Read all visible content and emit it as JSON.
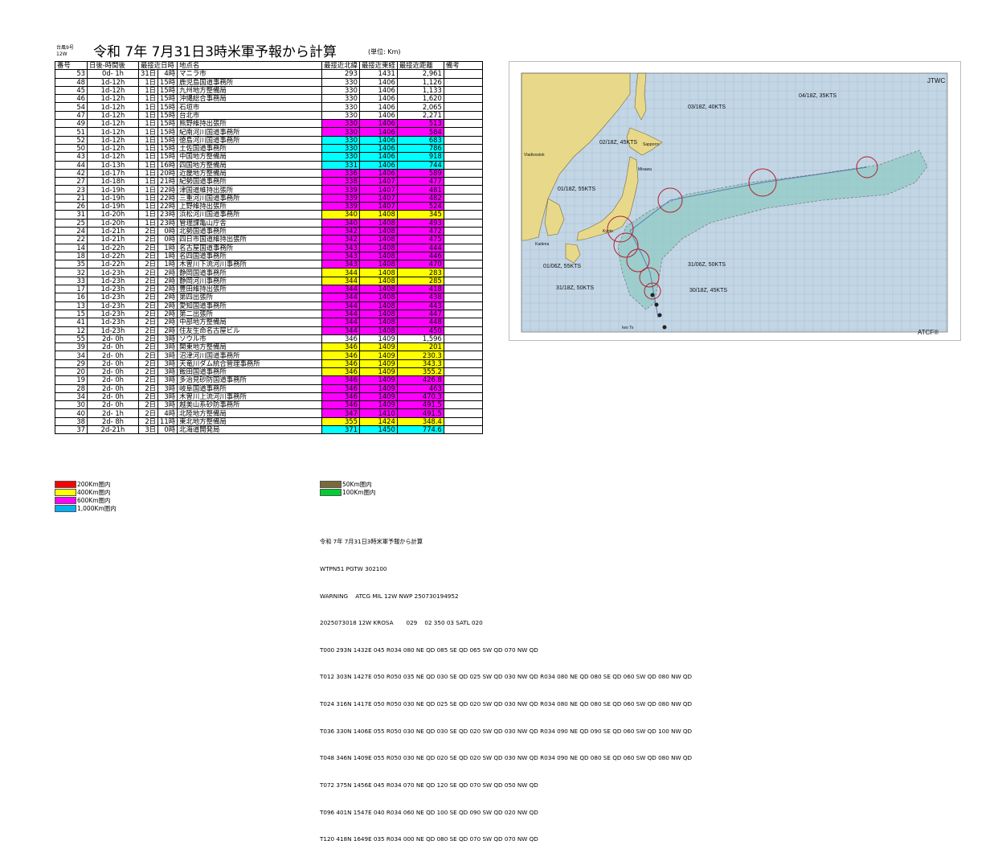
{
  "header": {
    "storm_label": "台風9号",
    "storm_sub": "12W",
    "title": "令和 7年 7月31日3時米軍予報から計算",
    "unit": "(単位: Km)"
  },
  "table": {
    "columns": [
      "番号",
      "日後-時間後",
      "最接近日時",
      "地点名",
      "最接近北緯",
      "最接近東経",
      "最接近距離",
      "備考"
    ],
    "rows": [
      {
        "no": "53",
        "after": "0d- 1h",
        "date": "31日",
        "time": "4時",
        "name": "マニラ市",
        "lat": "293",
        "lon": "1431",
        "dist": "2,961",
        "color": "none"
      },
      {
        "no": "48",
        "after": "1d-12h",
        "date": "1日",
        "time": "15時",
        "name": "鹿児島国道事務所",
        "lat": "330",
        "lon": "1406",
        "dist": "1,126",
        "color": "none"
      },
      {
        "no": "45",
        "after": "1d-12h",
        "date": "1日",
        "time": "15時",
        "name": "九州地方整備局",
        "lat": "330",
        "lon": "1406",
        "dist": "1,133",
        "color": "none"
      },
      {
        "no": "46",
        "after": "1d-12h",
        "date": "1日",
        "time": "15時",
        "name": "沖縄総合事務局",
        "lat": "330",
        "lon": "1406",
        "dist": "1,620",
        "color": "none"
      },
      {
        "no": "54",
        "after": "1d-12h",
        "date": "1日",
        "time": "15時",
        "name": "石垣市",
        "lat": "330",
        "lon": "1406",
        "dist": "2,065",
        "color": "none"
      },
      {
        "no": "47",
        "after": "1d-12h",
        "date": "1日",
        "time": "15時",
        "name": "台北市",
        "lat": "330",
        "lon": "1406",
        "dist": "2,271",
        "color": "none"
      },
      {
        "no": "49",
        "after": "1d-12h",
        "date": "1日",
        "time": "15時",
        "name": "熊野維持出張所",
        "lat": "330",
        "lon": "1406",
        "dist": "513",
        "color": "magenta"
      },
      {
        "no": "51",
        "after": "1d-12h",
        "date": "1日",
        "time": "15時",
        "name": "紀南河川国道事務所",
        "lat": "330",
        "lon": "1406",
        "dist": "584",
        "color": "magenta"
      },
      {
        "no": "52",
        "after": "1d-12h",
        "date": "1日",
        "time": "15時",
        "name": "徳島河川国道事務所",
        "lat": "330",
        "lon": "1406",
        "dist": "683",
        "color": "cyan"
      },
      {
        "no": "50",
        "after": "1d-12h",
        "date": "1日",
        "time": "15時",
        "name": "土佐国道事務所",
        "lat": "330",
        "lon": "1406",
        "dist": "786",
        "color": "cyan"
      },
      {
        "no": "43",
        "after": "1d-12h",
        "date": "1日",
        "time": "15時",
        "name": "中国地方整備局",
        "lat": "330",
        "lon": "1406",
        "dist": "918",
        "color": "cyan"
      },
      {
        "no": "44",
        "after": "1d-13h",
        "date": "1日",
        "time": "16時",
        "name": "四国地方整備局",
        "lat": "331",
        "lon": "1406",
        "dist": "744",
        "color": "cyan"
      },
      {
        "no": "42",
        "after": "1d-17h",
        "date": "1日",
        "time": "20時",
        "name": "近畿地方整備局",
        "lat": "336",
        "lon": "1406",
        "dist": "589",
        "color": "magenta"
      },
      {
        "no": "27",
        "after": "1d-18h",
        "date": "1日",
        "time": "21時",
        "name": "紀勢国道事務所",
        "lat": "338",
        "lon": "1407",
        "dist": "477",
        "color": "magenta"
      },
      {
        "no": "23",
        "after": "1d-19h",
        "date": "1日",
        "time": "22時",
        "name": "津国道維持出張所",
        "lat": "339",
        "lon": "1407",
        "dist": "481",
        "color": "magenta"
      },
      {
        "no": "21",
        "after": "1d-19h",
        "date": "1日",
        "time": "22時",
        "name": "三重河川国道事務所",
        "lat": "339",
        "lon": "1407",
        "dist": "482",
        "color": "magenta"
      },
      {
        "no": "26",
        "after": "1d-19h",
        "date": "1日",
        "time": "22時",
        "name": "上野維持出張所",
        "lat": "339",
        "lon": "1407",
        "dist": "524",
        "color": "magenta"
      },
      {
        "no": "31",
        "after": "1d-20h",
        "date": "1日",
        "time": "23時",
        "name": "浜松河川国道事務所",
        "lat": "340",
        "lon": "1408",
        "dist": "345",
        "color": "yellow"
      },
      {
        "no": "25",
        "after": "1d-20h",
        "date": "1日",
        "time": "23時",
        "name": "管理課亀山庁舎",
        "lat": "340",
        "lon": "1408",
        "dist": "493",
        "color": "magenta"
      },
      {
        "no": "24",
        "after": "1d-21h",
        "date": "2日",
        "time": "0時",
        "name": "北勢国道事務所",
        "lat": "342",
        "lon": "1408",
        "dist": "472",
        "color": "magenta"
      },
      {
        "no": "22",
        "after": "1d-21h",
        "date": "2日",
        "time": "0時",
        "name": "四日市国道維持出張所",
        "lat": "342",
        "lon": "1408",
        "dist": "475",
        "color": "magenta"
      },
      {
        "no": "14",
        "after": "1d-22h",
        "date": "2日",
        "time": "1時",
        "name": "名古屋国道事務所",
        "lat": "343",
        "lon": "1408",
        "dist": "444",
        "color": "magenta"
      },
      {
        "no": "18",
        "after": "1d-22h",
        "date": "2日",
        "time": "1時",
        "name": "名四国道事務所",
        "lat": "343",
        "lon": "1408",
        "dist": "446",
        "color": "magenta"
      },
      {
        "no": "35",
        "after": "1d-22h",
        "date": "2日",
        "time": "1時",
        "name": "木曽川下流河川事務所",
        "lat": "343",
        "lon": "1408",
        "dist": "470",
        "color": "magenta"
      },
      {
        "no": "32",
        "after": "1d-23h",
        "date": "2日",
        "time": "2時",
        "name": "静岡国道事務所",
        "lat": "344",
        "lon": "1408",
        "dist": "283",
        "color": "yellow"
      },
      {
        "no": "33",
        "after": "1d-23h",
        "date": "2日",
        "time": "2時",
        "name": "静岡河川事務所",
        "lat": "344",
        "lon": "1408",
        "dist": "285",
        "color": "yellow"
      },
      {
        "no": "17",
        "after": "1d-23h",
        "date": "2日",
        "time": "2時",
        "name": "豊田維持出張所",
        "lat": "344",
        "lon": "1408",
        "dist": "418",
        "color": "magenta"
      },
      {
        "no": "16",
        "after": "1d-23h",
        "date": "2日",
        "time": "2時",
        "name": "第四出張所",
        "lat": "344",
        "lon": "1408",
        "dist": "438",
        "color": "magenta"
      },
      {
        "no": "13",
        "after": "1d-23h",
        "date": "2日",
        "time": "2時",
        "name": "愛知国道事務所",
        "lat": "344",
        "lon": "1408",
        "dist": "443",
        "color": "magenta"
      },
      {
        "no": "15",
        "after": "1d-23h",
        "date": "2日",
        "time": "2時",
        "name": "第二出張所",
        "lat": "344",
        "lon": "1408",
        "dist": "447",
        "color": "magenta"
      },
      {
        "no": "41",
        "after": "1d-23h",
        "date": "2日",
        "time": "2時",
        "name": "中部地方整備局",
        "lat": "344",
        "lon": "1408",
        "dist": "448",
        "color": "magenta"
      },
      {
        "no": "12",
        "after": "1d-23h",
        "date": "2日",
        "time": "2時",
        "name": "住友生命名古屋ビル",
        "lat": "344",
        "lon": "1408",
        "dist": "450",
        "color": "magenta"
      },
      {
        "no": "55",
        "after": "2d- 0h",
        "date": "2日",
        "time": "3時",
        "name": "ソウル市",
        "lat": "346",
        "lon": "1409",
        "dist": "1,596",
        "color": "none"
      },
      {
        "no": "39",
        "after": "2d- 0h",
        "date": "2日",
        "time": "3時",
        "name": "関東地方整備局",
        "lat": "346",
        "lon": "1409",
        "dist": "201",
        "color": "yellow"
      },
      {
        "no": "34",
        "after": "2d- 0h",
        "date": "2日",
        "time": "3時",
        "name": "沼津河川国道事務所",
        "lat": "346",
        "lon": "1409",
        "dist": "230.3",
        "color": "yellow"
      },
      {
        "no": "29",
        "after": "2d- 0h",
        "date": "2日",
        "time": "3時",
        "name": "天竜川ダム統合管理事務所",
        "lat": "346",
        "lon": "1409",
        "dist": "343.3",
        "color": "yellow"
      },
      {
        "no": "20",
        "after": "2d- 0h",
        "date": "2日",
        "time": "3時",
        "name": "飯田国道事務所",
        "lat": "346",
        "lon": "1409",
        "dist": "355.2",
        "color": "yellow"
      },
      {
        "no": "19",
        "after": "2d- 0h",
        "date": "2日",
        "time": "3時",
        "name": "多治見砂防国道事務所",
        "lat": "346",
        "lon": "1409",
        "dist": "426.8",
        "color": "magenta"
      },
      {
        "no": "28",
        "after": "2d- 0h",
        "date": "2日",
        "time": "3時",
        "name": "岐阜国道事務所",
        "lat": "346",
        "lon": "1409",
        "dist": "463",
        "color": "magenta"
      },
      {
        "no": "34",
        "after": "2d- 0h",
        "date": "2日",
        "time": "3時",
        "name": "木曽川上流河川事務所",
        "lat": "346",
        "lon": "1409",
        "dist": "470.3",
        "color": "magenta"
      },
      {
        "no": "30",
        "after": "2d- 0h",
        "date": "2日",
        "time": "3時",
        "name": "越美山系砂防事務所",
        "lat": "346",
        "lon": "1409",
        "dist": "491.5",
        "color": "magenta"
      },
      {
        "no": "40",
        "after": "2d- 1h",
        "date": "2日",
        "time": "4時",
        "name": "北陸地方整備局",
        "lat": "347",
        "lon": "1410",
        "dist": "491.5",
        "color": "magenta"
      },
      {
        "no": "38",
        "after": "2d- 8h",
        "date": "2日",
        "time": "11時",
        "name": "東北地方整備局",
        "lat": "355",
        "lon": "1424",
        "dist": "348.4",
        "color": "yellow"
      },
      {
        "no": "37",
        "after": "2d-21h",
        "date": "3日",
        "time": "0時",
        "name": "北海道開発局",
        "lat": "371",
        "lon": "1450",
        "dist": "774.6",
        "color": "cyan"
      }
    ]
  },
  "legend": {
    "items": [
      {
        "label": "200Km圏内",
        "color": "#ff0000"
      },
      {
        "label": "400Km圏内",
        "color": "#ffff00"
      },
      {
        "label": "600Km圏内",
        "color": "#ff00ff"
      },
      {
        "label": "1,000Km圏内",
        "color": "#00b0f0"
      },
      {
        "label": "50Km圏内",
        "color": "#7a6a3a"
      },
      {
        "label": "100Km圏内",
        "color": "#00cc33"
      }
    ]
  },
  "colors": {
    "magenta": "#ff00ff",
    "cyan": "#00ffff",
    "yellow": "#ffff00"
  },
  "jtwc": {
    "lines": [
      "令和 7年 7月31日3時米軍予報から計算",
      "WTPN51 PGTW 302100",
      "WARNING    ATCG MIL 12W NWP 250730194952",
      "2025073018 12W KROSA       029    02 350 03 SATL 020",
      "T000 293N 1432E 045 R034 080 NE QD 085 SE QD 065 SW QD 070 NW QD",
      "T012 303N 1427E 050 R050 035 NE QD 030 SE QD 025 SW QD 030 NW QD R034 080 NE QD 080 SE QD 060 SW QD 080 NW QD",
      "T024 316N 1417E 050 R050 030 NE QD 025 SE QD 020 SW QD 030 NW QD R034 080 NE QD 080 SE QD 060 SW QD 080 NW QD",
      "T036 330N 1406E 055 R050 030 NE QD 030 SE QD 020 SW QD 030 NW QD R034 090 NE QD 090 SE QD 060 SW QD 100 NW QD",
      "T048 346N 1409E 055 R050 030 NE QD 020 SE QD 020 SW QD 030 NW QD R034 090 NE QD 080 SE QD 060 SW QD 080 NW QD",
      "T072 375N 1456E 045 R034 070 NE QD 120 SE QD 070 SW QD 050 NW QD",
      "T096 401N 1547E 040 R034 060 NE QD 100 SE QD 090 SW QD 020 NW QD",
      "T120 418N 1649E 035 R034 000 NE QD 080 SE QD 070 SW QD 070 NW QD"
    ]
  },
  "map": {
    "agency_label": "JTWC",
    "credit": "ATCF®",
    "forecast_labels": [
      "04/18Z, 35KTS",
      "03/18Z, 40KTS",
      "02/18Z, 45KTS",
      "01/18Z, 55KTS",
      "01/06Z, 55KTS",
      "31/06Z, 50KTS",
      "31/18Z, 50KTS",
      "30/18Z, 45KTS"
    ],
    "places": [
      "Vladivostok",
      "Sapporro",
      "Misawa",
      "Kyoto",
      "Kadena",
      "Iwo To"
    ]
  }
}
